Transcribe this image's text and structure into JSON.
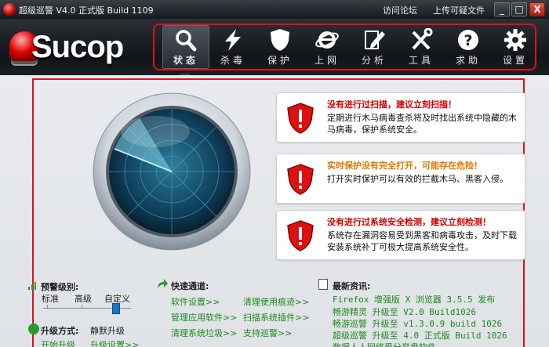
{
  "window": {
    "title": "超级巡警 V4.0 正式版 Build 1109",
    "links": [
      "访问论坛",
      "上传可疑文件"
    ],
    "minimize": "_",
    "maximize": "□",
    "close": "X"
  },
  "logo": {
    "text": "Sucop"
  },
  "nav": {
    "items": [
      {
        "label": "状态",
        "icon": "magnifier-icon",
        "active": true
      },
      {
        "label": "杀毒",
        "icon": "lightning-icon",
        "active": false
      },
      {
        "label": "保护",
        "icon": "shield-icon",
        "active": false
      },
      {
        "label": "上网",
        "icon": "ie-icon",
        "active": false
      },
      {
        "label": "分析",
        "icon": "pencil-icon",
        "active": false
      },
      {
        "label": "工具",
        "icon": "tools-icon",
        "active": false
      },
      {
        "label": "求助",
        "icon": "question-icon",
        "active": false
      },
      {
        "label": "设置",
        "icon": "gear-icon",
        "active": false
      }
    ]
  },
  "alerts": [
    {
      "title": "没有进行过扫描，建议立刻扫描！",
      "color": "#d40000",
      "desc": "定期进行木马病毒查杀将及时找出系统中隐藏的木马病毒，保护系统安全。"
    },
    {
      "title": "实时保护没有完全打开，可能存在危险！",
      "color": "#e07800",
      "desc": "打开实时保护可以有效的拦截木马、黑客入侵。"
    },
    {
      "title": "没有进行过系统安全检测，建议立刻检测！",
      "color": "#d40000",
      "desc": "系统存在漏洞容易受到黑客和病毒攻击，及时下载安装系统补丁可极大提高系统安全性。"
    }
  ],
  "alarm": {
    "title": "预警级别:",
    "levels": [
      "标准",
      "高级",
      "自定义"
    ],
    "selected": "自定义"
  },
  "upgrade": {
    "title": "升级方式:",
    "mode": "静默升级",
    "links": [
      "开始升级",
      "升级设置>>"
    ]
  },
  "quick": {
    "title": "快速通道:",
    "links": [
      "软件设置>>",
      "清理使用痕迹>>",
      "管理应用软件>>",
      "扫描系统插件>>",
      "清理系统垃圾>>",
      "支持巡警>>"
    ]
  },
  "news": {
    "title": "最新资讯:",
    "items": [
      "Firefox 增强版 X 浏览器 3.5.5 发布",
      "畅游精灵 升级至 V2.0 Build1026",
      "畅游巡警 升级至 v1.3.0.9 build 1026",
      "超级巡警 升级至 4.0 正式版 Build 1026",
      "数据人人网络爱分享盘软件"
    ]
  },
  "colors": {
    "accent": "#e0101a",
    "link": "#1a8a1a",
    "slider": "#1a72c9"
  }
}
